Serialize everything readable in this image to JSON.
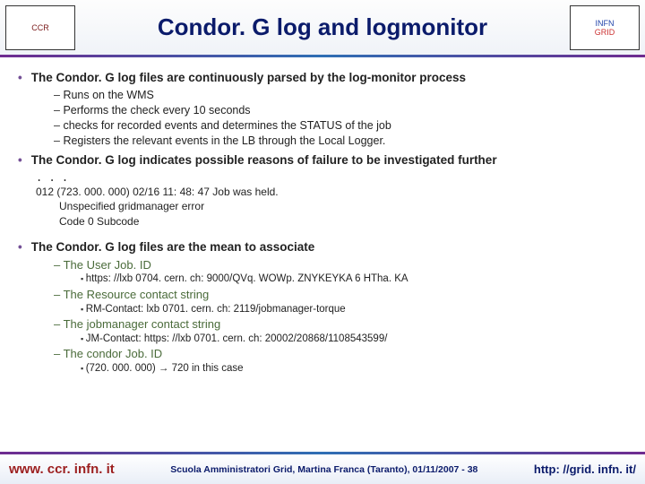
{
  "header": {
    "logo_left_text": "CCR",
    "title": "Condor. G log and logmonitor",
    "logo_right_top": "INFN",
    "logo_right_bottom": "GRID"
  },
  "bullets": {
    "b1": "The Condor. G log files are continuously parsed by the log-monitor process",
    "b1_sub": [
      "Runs on the WMS",
      "Performs the check every 10 seconds",
      "checks for recorded events and determines the STATUS of the job",
      "Registers the relevant events in the LB through the Local Logger."
    ],
    "b2": "The Condor. G log indicates possible reasons of failure to be investigated further",
    "ellipsis": ". . .",
    "log_line1": "012 (723. 000. 000) 02/16 11: 48: 47 Job was held.",
    "log_line2": "Unspecified gridmanager error",
    "log_line3": "Code 0 Subcode",
    "b3": "The Condor. G log files are the mean to associate",
    "assoc": [
      {
        "label": "The User Job. ID",
        "detail": "https: //lxb 0704. cern. ch: 9000/QVq. WOWp. ZNYKEYKA 6 HTha. KA"
      },
      {
        "label": "The Resource contact string",
        "detail": "RM-Contact: lxb 0701. cern. ch: 2119/jobmanager-torque"
      },
      {
        "label": "The jobmanager contact string",
        "detail": "JM-Contact: https: //lxb 0701. cern. ch: 20002/20868/1108543599/"
      },
      {
        "label": "The condor Job. ID",
        "detail": "(720. 000. 000) → 720 in this case"
      }
    ]
  },
  "footer": {
    "left": "www. ccr. infn. it",
    "center": "Scuola Amministratori Grid, Martina Franca (Taranto), 01/11/2007 - 38",
    "right": "http: //grid. infn. it/"
  }
}
